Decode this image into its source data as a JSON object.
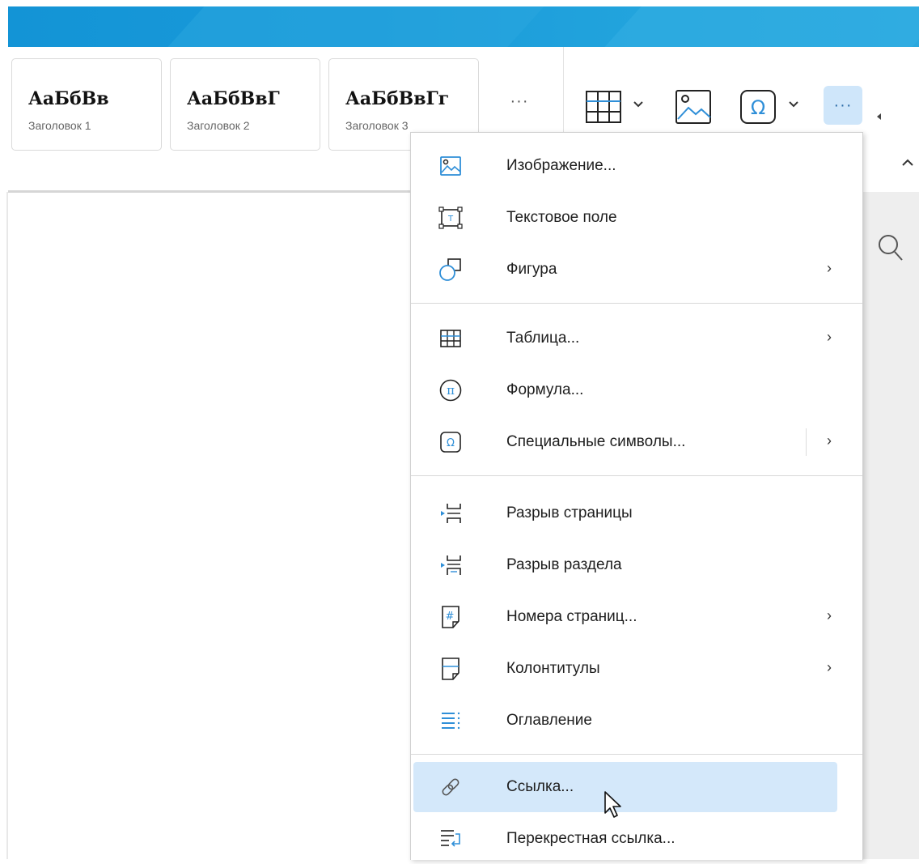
{
  "styles_gallery": [
    {
      "sample": "АаБбВв",
      "caption": "Заголовок 1"
    },
    {
      "sample": "АаБбВвГ",
      "caption": "Заголовок 2"
    },
    {
      "sample": "АаБбВвГг",
      "caption": "Заголовок 3"
    }
  ],
  "toolbar": {
    "more_styles": "···",
    "more_insert": "···",
    "symbol_glyph": "Ω"
  },
  "menu": {
    "items": [
      {
        "label": "Изображение...",
        "icon": "image-icon",
        "submenu": false
      },
      {
        "label": "Текстовое поле",
        "icon": "text-box-icon",
        "submenu": false
      },
      {
        "label": "Фигура",
        "icon": "shape-icon",
        "submenu": true
      },
      {
        "label": "Таблица...",
        "icon": "table-icon",
        "submenu": true
      },
      {
        "label": "Формула...",
        "icon": "formula-icon",
        "glyph": "π",
        "submenu": false
      },
      {
        "label": "Специальные символы...",
        "icon": "omega-icon",
        "glyph": "Ω",
        "submenu": true
      },
      {
        "label": "Разрыв страницы",
        "icon": "page-break-icon",
        "submenu": false
      },
      {
        "label": "Разрыв раздела",
        "icon": "section-break-icon",
        "submenu": false
      },
      {
        "label": "Номера страниц...",
        "icon": "page-numbers-icon",
        "glyph": "#",
        "submenu": true
      },
      {
        "label": "Колонтитулы",
        "icon": "header-footer-icon",
        "submenu": true
      },
      {
        "label": "Оглавление",
        "icon": "toc-icon",
        "submenu": false
      },
      {
        "label": "Ссылка...",
        "icon": "link-icon",
        "submenu": false,
        "highlighted": true
      },
      {
        "label": "Перекрестная ссылка...",
        "icon": "cross-reference-icon",
        "submenu": false
      }
    ],
    "submenu_arrow": "›"
  },
  "colors": {
    "accent": "#1a9ad9",
    "icon_blue": "#2f8fd8",
    "highlight": "#d4e8fa"
  }
}
